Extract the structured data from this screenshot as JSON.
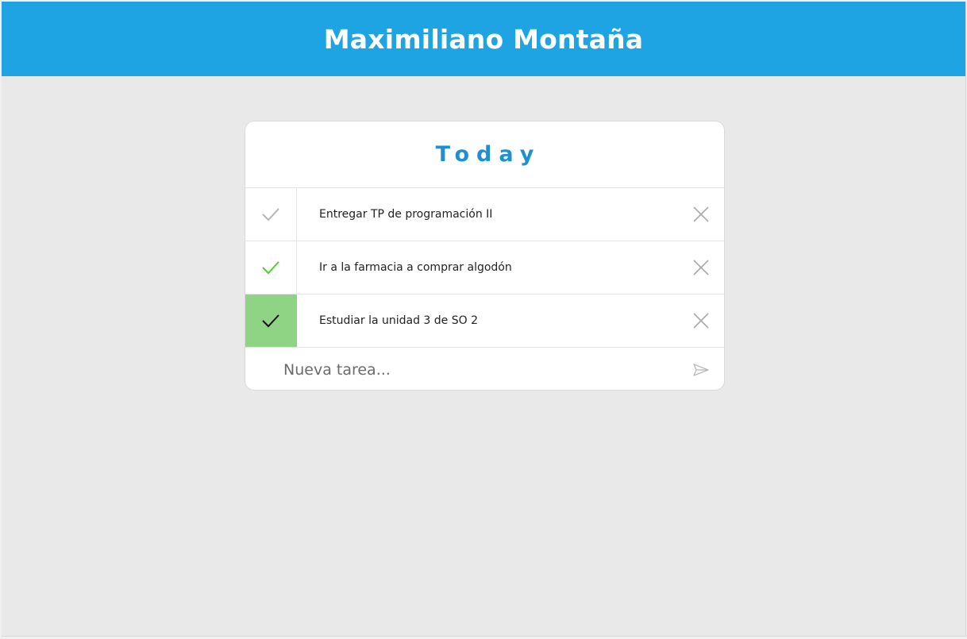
{
  "header": {
    "title": "Maximiliano Montaña"
  },
  "card": {
    "title": "Today",
    "tasks": [
      {
        "text": "Entregar TP de programación II",
        "check_state": "unchecked",
        "check_color": "#b5b5b5"
      },
      {
        "text": "Ir a la farmacia a comprar algodón",
        "check_state": "hover",
        "check_color": "#4cd12a"
      },
      {
        "text": "Estudiar la unidad 3 de SO 2",
        "check_state": "done",
        "check_color": "#111111"
      }
    ],
    "new_task": {
      "placeholder": "Nueva tarea...",
      "value": ""
    }
  },
  "icons": {
    "check": "check-icon",
    "delete": "close-icon",
    "send": "send-icon"
  },
  "colors": {
    "header_bg": "#1fa4e3",
    "title_color": "#1f8fd0",
    "done_bg": "#8fd484",
    "background": "#e9e9e9"
  }
}
